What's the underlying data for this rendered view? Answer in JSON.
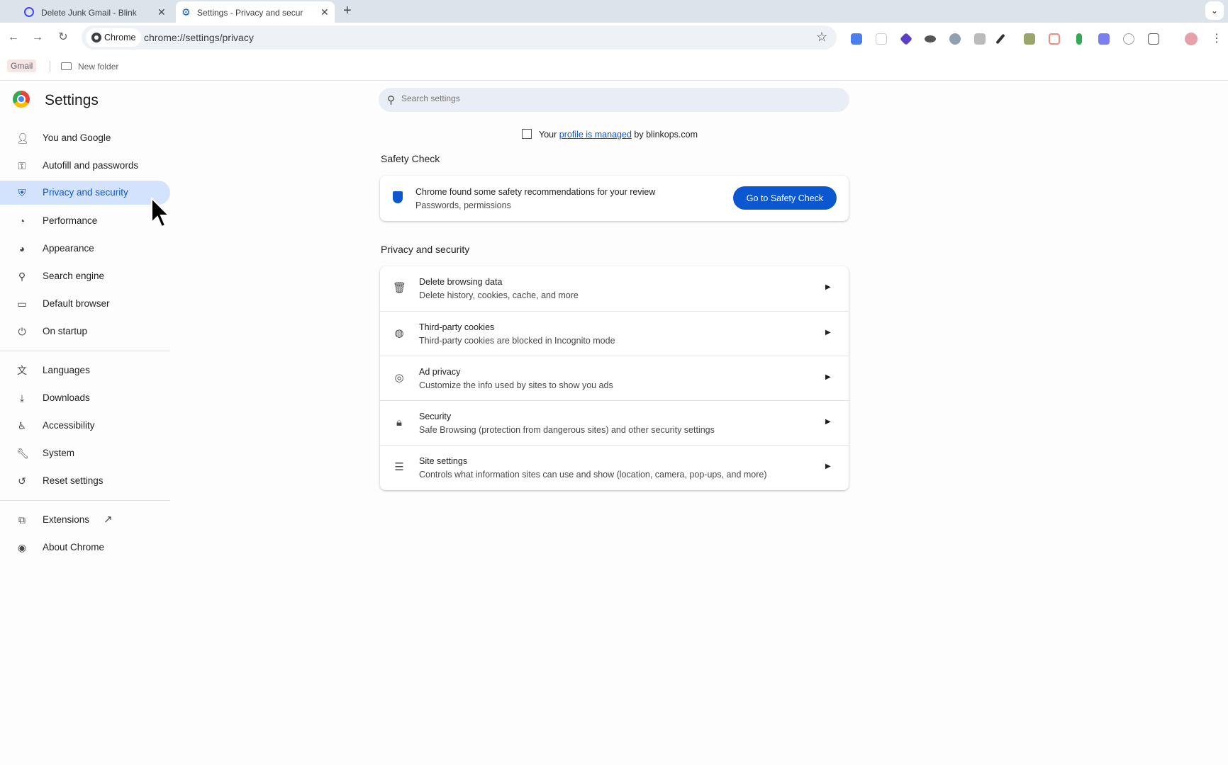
{
  "tabs": [
    {
      "title": "Delete Junk Gmail - Blink",
      "active": false
    },
    {
      "title": "Settings - Privacy and securi",
      "active": true
    }
  ],
  "toolbar": {
    "site_chip": "Chrome",
    "url": "chrome://settings/privacy"
  },
  "bookmarks": {
    "gmail": "Gmail",
    "folder": "New folder"
  },
  "sidebar": {
    "title": "Settings",
    "items": [
      {
        "label": "You and Google",
        "icon": "person-icon"
      },
      {
        "label": "Autofill and passwords",
        "icon": "key-icon"
      },
      {
        "label": "Privacy and security",
        "icon": "shield-icon",
        "active": true
      },
      {
        "label": "Performance",
        "icon": "speedometer-icon"
      },
      {
        "label": "Appearance",
        "icon": "palette-icon"
      },
      {
        "label": "Search engine",
        "icon": "search-icon"
      },
      {
        "label": "Default browser",
        "icon": "browser-window-icon"
      },
      {
        "label": "On startup",
        "icon": "power-icon"
      },
      {
        "label": "Languages",
        "icon": "translate-icon"
      },
      {
        "label": "Downloads",
        "icon": "download-icon"
      },
      {
        "label": "Accessibility",
        "icon": "accessibility-icon"
      },
      {
        "label": "System",
        "icon": "wrench-icon"
      },
      {
        "label": "Reset settings",
        "icon": "reset-icon"
      },
      {
        "label": "Extensions",
        "icon": "puzzle-icon"
      },
      {
        "label": "About Chrome",
        "icon": "chrome-icon"
      }
    ]
  },
  "search": {
    "placeholder": "Search settings"
  },
  "managed": {
    "prefix": "Your",
    "link": "profile is managed",
    "suffix": "by blinkops.com"
  },
  "safety_check": {
    "heading": "Safety Check",
    "title": "Chrome found some safety recommendations for your review",
    "subtitle": "Passwords, permissions",
    "button": "Go to Safety Check"
  },
  "privacy": {
    "heading": "Privacy and security",
    "rows": [
      {
        "title": "Delete browsing data",
        "subtitle": "Delete history, cookies, cache, and more",
        "icon": "trash-icon"
      },
      {
        "title": "Third-party cookies",
        "subtitle": "Third-party cookies are blocked in Incognito mode",
        "icon": "cookie-icon"
      },
      {
        "title": "Ad privacy",
        "subtitle": "Customize the info used by sites to show you ads",
        "icon": "ad-privacy-icon"
      },
      {
        "title": "Security",
        "subtitle": "Safe Browsing (protection from dangerous sites) and other security settings",
        "icon": "lock-icon"
      },
      {
        "title": "Site settings",
        "subtitle": "Controls what information sites can use and show (location, camera, pop-ups, and more)",
        "icon": "sliders-icon"
      }
    ]
  },
  "colors": {
    "accent": "#0b57d0",
    "active_nav_bg": "#d3e3fd"
  }
}
